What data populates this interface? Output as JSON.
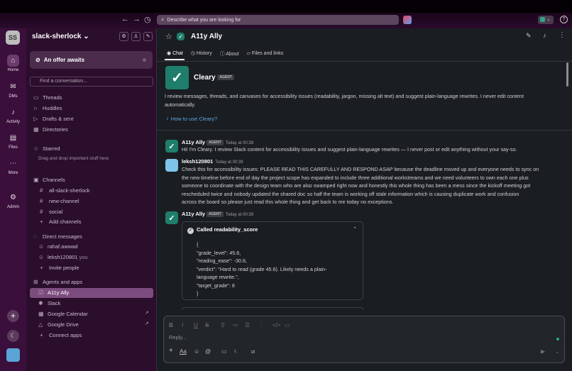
{
  "search": {
    "placeholder": "Describe what you are looking for"
  },
  "rail": {
    "workspace_initials": "SS",
    "items": [
      {
        "label": "Home"
      },
      {
        "label": "DMs"
      },
      {
        "label": "Activity"
      },
      {
        "label": "Files"
      },
      {
        "label": "More"
      },
      {
        "label": "Admin"
      }
    ]
  },
  "sidebar": {
    "workspace_name": "slack-sherlock",
    "offer": "An offer awaits",
    "find_placeholder": "Find a conversation...",
    "nav": [
      "Threads",
      "Huddles",
      "Drafts & sent",
      "Directories"
    ],
    "starred_title": "Starred",
    "starred_hint": "Drag and drop important stuff here",
    "channels_title": "Channels",
    "channels": [
      "all-slack-sherlock",
      "new-channel",
      "social"
    ],
    "add_channels": "Add channels",
    "dm_title": "Direct messages",
    "dms": [
      "rahaf.awwad",
      "leksh120801"
    ],
    "dm_you": "you",
    "invite": "Invite people",
    "apps_title": "Agents and apps",
    "apps": [
      "A11y Ally",
      "Slack",
      "Google Calendar",
      "Google Drive"
    ],
    "connect": "Connect apps"
  },
  "channel": {
    "title": "A11y Ally",
    "tabs": [
      "Chat",
      "History",
      "About",
      "Files and links"
    ]
  },
  "intro": {
    "name": "Cleary",
    "badge": "AGENT",
    "description_line1": "I review messages, threads, and canvases for accessibility issues (readability, jargon, missing alt text) and suggest plain-language rewrites. I never edit content",
    "description_line2": "automatically.",
    "how_to": "How to use Cleary?"
  },
  "messages": [
    {
      "author": "A11y Ally",
      "badge": "AGENT",
      "time": "Today at 00:38",
      "lines": [
        "Hi! I'm Cleary. I review Slack content for accessibility issues and suggest plain-language rewrites — I never post or edit anything without your say-so."
      ]
    },
    {
      "author": "leksh120801",
      "time": "Today at 00:39",
      "lines": [
        "Check this for accessibility issues: PLEASE READ THIS CAREFULLY AND RESPOND ASAP because the deadline moved up and everyone needs to sync on",
        "the new timeline before end of day the project scope has expanded to include three additional workstreams and we need volunteers to own each one plus",
        "someone to coordinate with the design team who are also swamped right now and honestly this whole thing has been a mess since the kickoff meeting got",
        "rescheduled twice and nobody updated the shared doc so half the team is working off stale information which is causing duplicate work and confusion",
        "across the board so please just read this whole thing and get back to me today no exceptions."
      ]
    },
    {
      "author": "A11y Ally",
      "badge": "AGENT",
      "time": "Today at 00:39"
    }
  ],
  "tool_call": {
    "title": "Called readability_score",
    "lines": [
      "{",
      "\"grade_level\": 45.6,",
      "\"reading_ease\": -30.6,",
      "\"verdict\": \"Hard to read (grade 45.6). Likely needs a plain-",
      "language rewrite.\",",
      "\"target_grade\": 8",
      "}"
    ]
  },
  "composer": {
    "placeholder": "Reply..."
  },
  "colors": {
    "rail": "#3a0f3b",
    "sidebar": "#2b0d2c",
    "active_item": "#7c4c7e",
    "agent": "#1e7e6b",
    "main": "#1a1d21"
  }
}
